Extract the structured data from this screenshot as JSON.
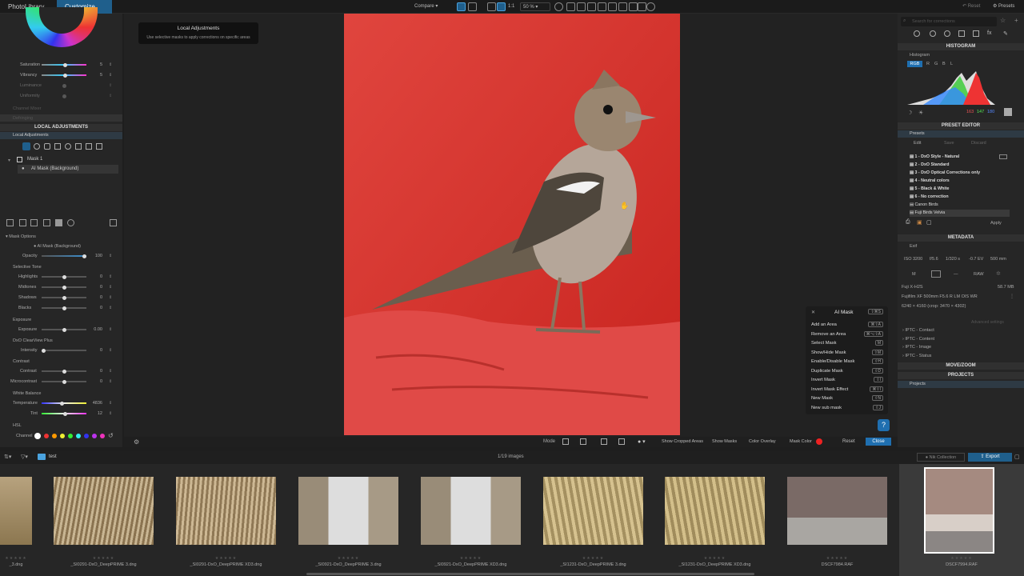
{
  "topbar": {
    "tab_library": "PhotoLibrary",
    "tab_customize": "Customize",
    "compare": "Compare",
    "ratio": "1:1",
    "zoom": "50 %",
    "reset": "Reset",
    "presets": "Presets"
  },
  "tooltip": {
    "title": "Local Adjustments",
    "desc": "Use selective masks to apply corrections on specific areas"
  },
  "left": {
    "color_rows": [
      {
        "label": "Saturation",
        "value": "5"
      },
      {
        "label": "Vibrancy",
        "value": "5"
      },
      {
        "label": "Luminance",
        "value": ""
      },
      {
        "label": "Uniformity",
        "value": ""
      }
    ],
    "channel_mixer": "Channel Mixer",
    "defringing": "Defringing",
    "local_adjustments_header": "LOCAL ADJUSTMENTS",
    "local_adjustments_row": "Local Adjustments",
    "mask1": "Mask 1",
    "ai_mask_bg": "AI Mask (Background)",
    "mask_options": "Mask Options",
    "mask_options_sub": "AI Mask (Background)",
    "opacity": {
      "label": "Opacity",
      "value": "100"
    },
    "selective_tone": "Selective Tone",
    "tone_rows": [
      {
        "label": "Highlights",
        "value": "0"
      },
      {
        "label": "Midtones",
        "value": "0"
      },
      {
        "label": "Shadows",
        "value": "0"
      },
      {
        "label": "Blacks",
        "value": "0"
      }
    ],
    "exposure_section": "Exposure",
    "exposure": {
      "label": "Exposure",
      "value": "0.00"
    },
    "clearview_section": "DxO ClearView Plus",
    "intensity": {
      "label": "Intensity",
      "value": "0"
    },
    "contrast_section": "Contrast",
    "contrast_rows": [
      {
        "label": "Contrast",
        "value": "0"
      },
      {
        "label": "Microcontrast",
        "value": "0"
      }
    ],
    "wb_section": "White Balance",
    "wb_rows": [
      {
        "label": "Temperature",
        "value": "4836"
      },
      {
        "label": "Tint",
        "value": "12"
      }
    ],
    "hsl_section": "HSL",
    "channel_label": "Channel"
  },
  "center_bar": {
    "mode": "Mode",
    "show_cropped": "Show Cropped Areas",
    "show_masks": "Show Masks",
    "color_overlay": "Color Overlay",
    "mask_color": "Mask Color",
    "reset": "Reset",
    "close": "Close"
  },
  "aimask": {
    "title": "AI Mask",
    "title_key": "⇧⌘S",
    "items": [
      {
        "label": "Add an Area",
        "key": "⌘⇧A"
      },
      {
        "label": "Remove an Area",
        "key": "⌘⌥⇧A"
      },
      {
        "label": "Select Mask",
        "key": "M"
      },
      {
        "label": "Show/Hide Mask",
        "key": "⇧M"
      },
      {
        "label": "Enable/Disable Mask",
        "key": "⇧H"
      },
      {
        "label": "Duplicate Mask",
        "key": "⇧D"
      },
      {
        "label": "Invert Mask",
        "key": "⇧I"
      },
      {
        "label": "Invert Mask Effect",
        "key": "⌘⇧I"
      },
      {
        "label": "New Mask",
        "key": "⇧N"
      },
      {
        "label": "New sub mask",
        "key": "⇧J"
      }
    ]
  },
  "right": {
    "search_placeholder": "Search for corrections",
    "histogram": "HISTOGRAM",
    "histogram_sub": "Histogram",
    "rgb": "RGB",
    "ch_r": "R",
    "ch_g": "G",
    "ch_b": "B",
    "ch_l": "L",
    "hist_r": "163",
    "hist_g": "147",
    "hist_b": "180",
    "preset_editor": "PRESET EDITOR",
    "presets_label": "Presets",
    "edit": "Edit",
    "save": "Save",
    "discard": "Discard",
    "preset_list": [
      "1 - DxO Style - Natural",
      "2 - DxO Standard",
      "3 - DxO Optical Corrections only",
      "4 - Neutral colors",
      "5 - Black & White",
      "6 - No correction",
      "Canon Birds",
      "Fuji Birds Velvia"
    ],
    "apply": "Apply",
    "metadata": "METADATA",
    "exif": "Exif",
    "exif_vals": [
      "ISO 3200",
      "f/5.6",
      "1/320 s",
      "-0.7 EV",
      "500 mm"
    ],
    "exif_icons": [
      "M",
      "",
      "—",
      "RAW",
      ""
    ],
    "camera": "Fuji X-H2S",
    "size": "58.7 MB",
    "lens": "Fujifilm XF 500mm F5.6 R LM OIS WR",
    "dims": "6240 × 4160 (crop: 3470 × 4302)",
    "advanced": "Advanced settings",
    "iptc": [
      "IPTC - Contact",
      "IPTC - Content",
      "IPTC - Image",
      "IPTC - Status"
    ],
    "move_zoom": "MOVE/ZOOM",
    "projects": "PROJECTS",
    "projects_item": "Projects"
  },
  "film": {
    "folder": "test",
    "count": "1/19 images",
    "nik": "Nik Collection",
    "export": "Export",
    "captions": [
      "_3.dng",
      "_SI0291-DxO_DeepPRIME 3.dng",
      "_SI0291-DxO_DeepPRIME XD3.dng",
      "_SI0921-DxO_DeepPRIME 3.dng",
      "_SI0921-DxO_DeepPRIME XD3.dng",
      "_SI1231-DxO_DeepPRIME 3.dng",
      "_SI1231-DxO_DeepPRIME XD3.dng",
      "DSCF7984.RAF",
      "DSCF7994.RAF"
    ]
  }
}
